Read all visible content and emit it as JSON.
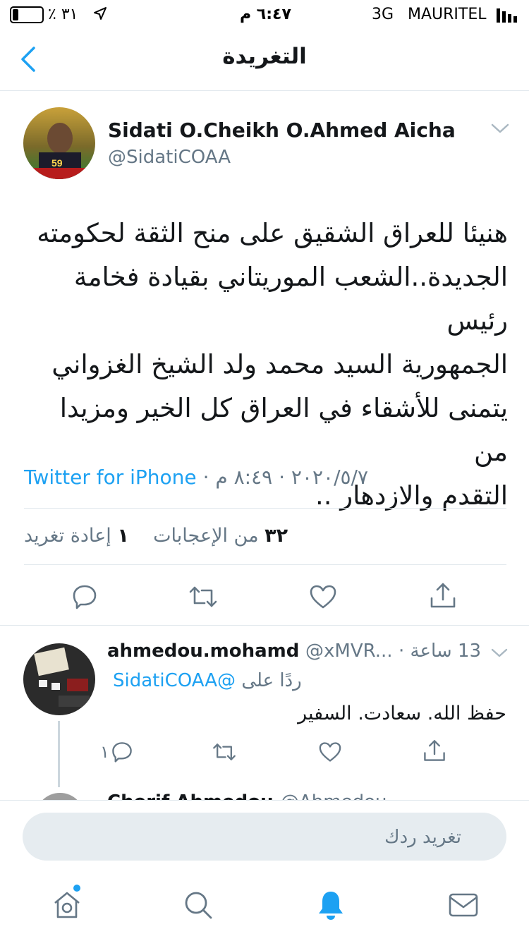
{
  "status_bar": {
    "carrier": "MAURITEL",
    "network": "3G",
    "time": "٦:٤٧ م",
    "battery": "٪ ٣١"
  },
  "nav": {
    "title": "التغريدة",
    "back_icon": "chevron-left-icon"
  },
  "tweet": {
    "author_name": "Sidati O.Cheikh O.Ahmed Aicha",
    "author_handle": "@SidatiCOAA",
    "avatar_badge": "59",
    "text_lines": [
      "هنيئا للعراق الشقيق على منح الثقة لحكومته",
      "الجديدة..الشعب الموريتاني بقيادة فخامة رئيس",
      "الجمهورية السيد محمد ولد الشيخ الغزواني",
      "يتمنى للأشقاء في العراق كل الخير ومزيدا من",
      "التقدم والازدهار .."
    ],
    "time": "٨:٤٩ م",
    "date": "٢٠٢٠/٥/٧",
    "client": "Twitter for iPhone",
    "likes_count": "٣٢",
    "likes_label": "من الإعجابات",
    "retweets_count": "١",
    "retweets_label": "إعادة تغريد"
  },
  "reply": {
    "author_name": "ahmedou.mohamd",
    "author_handle": "@xMVR...",
    "time": "13 ساعة",
    "replying_to_label": "ردًا على",
    "replying_to_handle": "@SidatiCOAA",
    "text": "حفظ الله. سعادت. السفير",
    "reply_count": "١"
  },
  "next_reply_partial": {
    "author_name": "Cherif Ahmedou",
    "author_handle": "@Ahmedou"
  },
  "compose": {
    "placeholder": "تغريد ردك"
  },
  "tabbar": {
    "items": [
      "home-icon",
      "search-icon",
      "notifications-icon",
      "messages-icon"
    ],
    "active": "notifications-icon"
  },
  "colors": {
    "accent": "#1da1f2",
    "secondary_text": "#657786",
    "divider": "#e1e8ed"
  }
}
